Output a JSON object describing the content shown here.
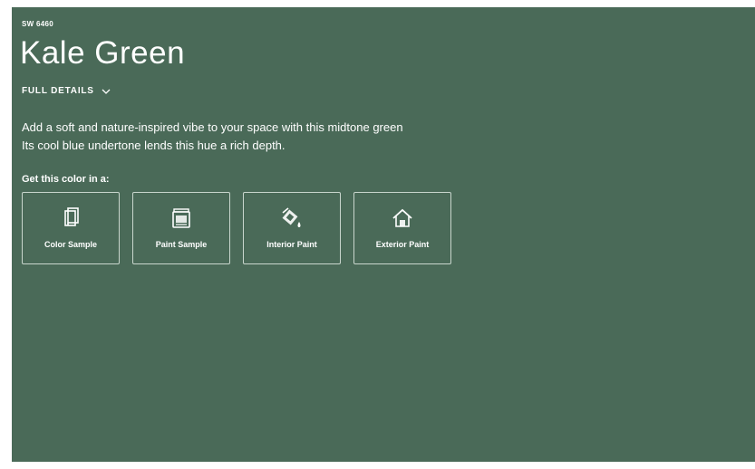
{
  "color": {
    "code": "SW 6460",
    "name": "Kale Green",
    "full_details_label": "FULL DETAILS",
    "description_line1": "Add a soft and nature-inspired vibe to your space with this midtone green",
    "description_line2": "Its cool blue undertone lends this hue a rich depth.",
    "swatch_hex": "#4a6a58"
  },
  "purchase": {
    "heading": "Get this color in a:",
    "options": [
      {
        "label": "Color Sample",
        "icon": "color-sample-icon"
      },
      {
        "label": "Paint Sample",
        "icon": "paint-can-icon"
      },
      {
        "label": "Interior Paint",
        "icon": "paint-bucket-icon"
      },
      {
        "label": "Exterior Paint",
        "icon": "house-icon"
      }
    ]
  }
}
